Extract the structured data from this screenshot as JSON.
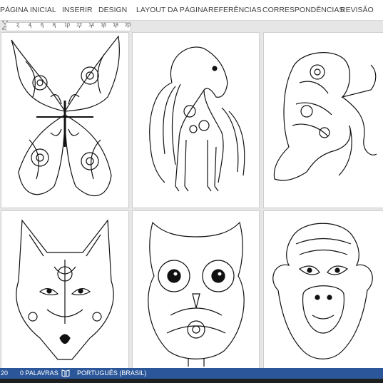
{
  "ribbon": {
    "tabs": [
      "PÁGINA INICIAL",
      "INSERIR",
      "DESIGN",
      "LAYOUT DA PÁGINA",
      "REFERÊNCIAS",
      "CORRESPONDÊNCIAS",
      "REVISÃO"
    ]
  },
  "ruler": {
    "numbers": [
      "2",
      "4",
      "6",
      "8",
      "10",
      "12",
      "14",
      "16",
      "18",
      "20"
    ]
  },
  "pages": [
    {
      "icon": "butterfly-mandala-icon"
    },
    {
      "icon": "horse-mandala-icon"
    },
    {
      "icon": "elephant-mandala-icon"
    },
    {
      "icon": "fox-mandala-icon"
    },
    {
      "icon": "owl-mandala-icon"
    },
    {
      "icon": "monkey-mandala-icon"
    }
  ],
  "status": {
    "page_count": "20",
    "words": "0 PALAVRAS",
    "proofing_icon": "book-check-icon",
    "language": "PORTUGUÊS (BRASIL)"
  },
  "colors": {
    "status_bar": "#2b579a",
    "workspace": "#e6e6e6"
  }
}
